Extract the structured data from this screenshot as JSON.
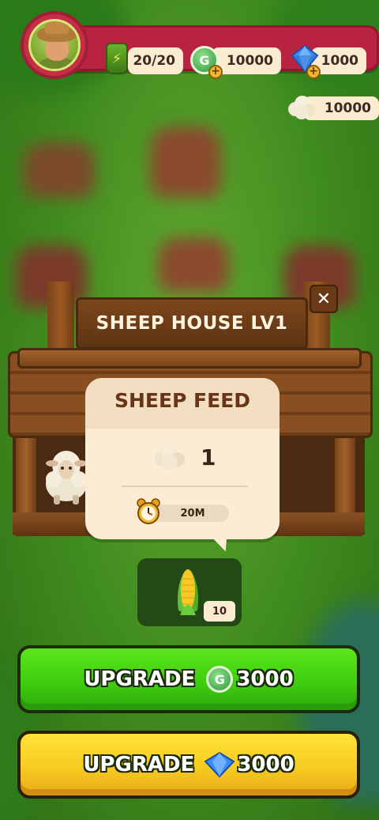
{
  "hud": {
    "energy": "20/20",
    "coins": "10000",
    "gems": "1000",
    "cotton": "10000"
  },
  "building": {
    "title": "SHEEP HOUSE LV1",
    "close_icon": "✕"
  },
  "feed_popup": {
    "title": "SHEEP FEED",
    "quantity": "1",
    "timer": "20M"
  },
  "feed_slot": {
    "item": "corn",
    "count": "10"
  },
  "buttons": {
    "upgrade_coin_label": "UPGRADE",
    "upgrade_coin_cost": "3000",
    "upgrade_gem_label": "UPGRADE",
    "upgrade_gem_cost": "3000"
  },
  "colors": {
    "hud_bar": "#b8233f",
    "green_button": "#3fcf10",
    "yellow_button": "#f7cc1e",
    "popup_bg": "#fbecd3"
  },
  "icons": [
    "avatar-farmer",
    "energy-bottle-icon",
    "coin-icon",
    "gem-icon",
    "cotton-icon",
    "close-icon",
    "clock-icon",
    "corn-icon",
    "sheep"
  ]
}
